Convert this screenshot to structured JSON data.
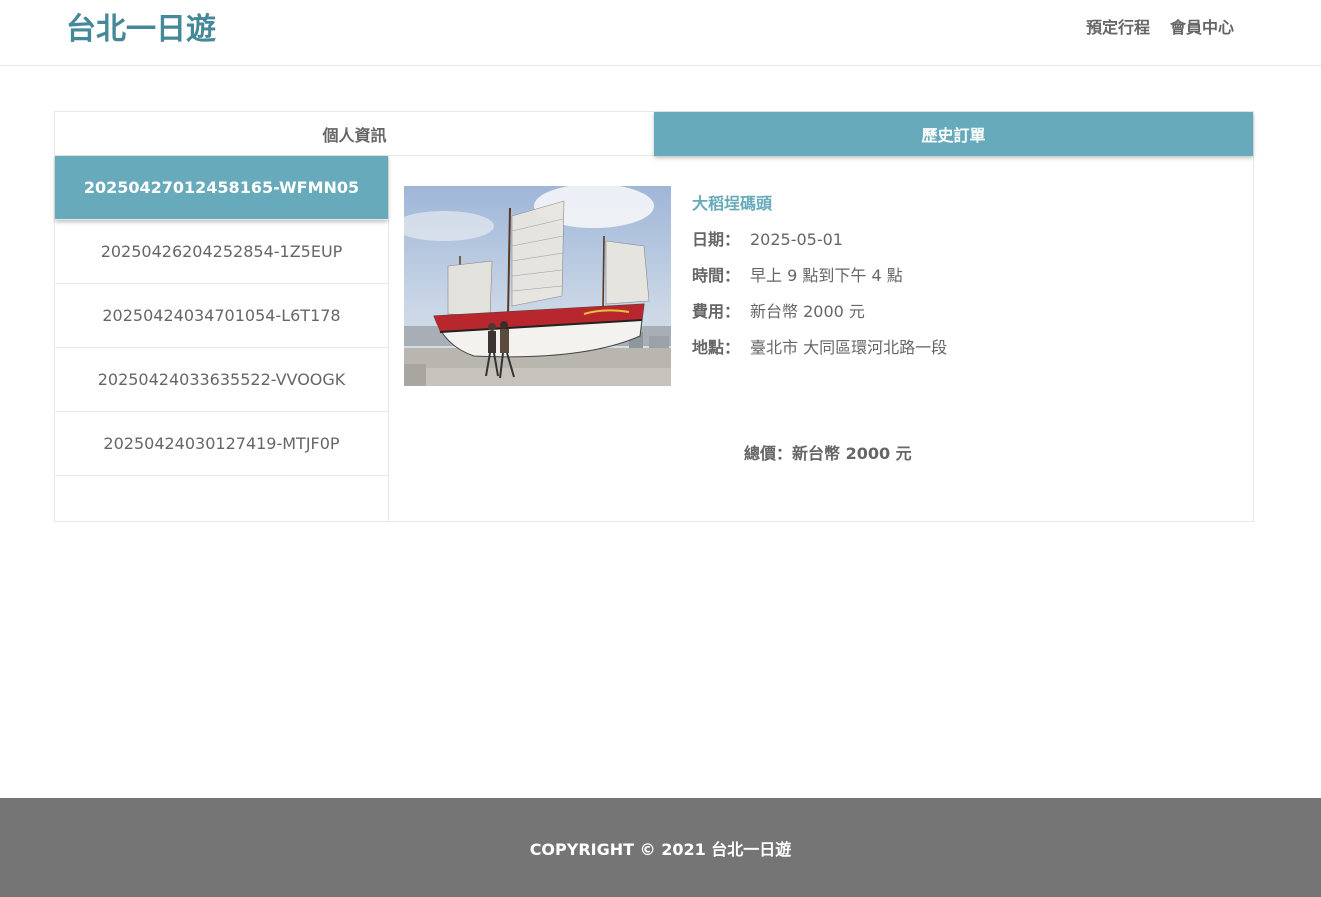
{
  "header": {
    "brand": "台北一日遊",
    "nav": [
      "預定行程",
      "會員中心"
    ]
  },
  "tabs": [
    {
      "label": "個人資訊",
      "active": false
    },
    {
      "label": "歷史訂單",
      "active": true
    }
  ],
  "orders": [
    "20250427012458165-WFMN05",
    "20250426204252854-1Z5EUP",
    "20250424034701054-L6T178",
    "20250424033635522-VVOOGK",
    "20250424030127419-MTJF0P"
  ],
  "detail": {
    "attraction": "大稻埕碼頭",
    "date_label": "日期：",
    "date": "2025-05-01",
    "time_label": "時間：",
    "time": "早上 9 點到下午 4 點",
    "price_label": "費用：",
    "price": "新台幣 2000 元",
    "location_label": "地點：",
    "location": "臺北市 大同區環河北路一段",
    "total": "總價：新台幣 2000 元"
  },
  "footer": {
    "copyright": "COPYRIGHT © 2021 台北一日遊"
  },
  "colors": {
    "accent": "#66aabb",
    "brand": "#448899",
    "footer_bg": "#757575"
  }
}
